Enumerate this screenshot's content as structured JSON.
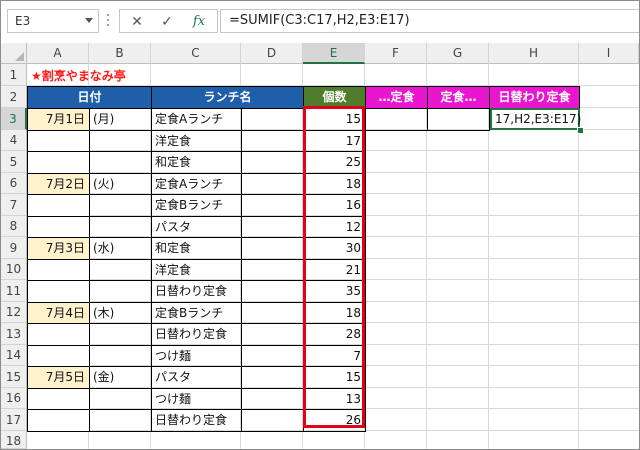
{
  "formula_bar": {
    "name_box": "E3",
    "cancel_icon": "✕",
    "enter_icon": "✓",
    "fx_label": "fx",
    "formula": "=SUMIF(C3:C17,H2,E3:E17)"
  },
  "columns": [
    "A",
    "B",
    "C",
    "D",
    "E",
    "F",
    "G",
    "H",
    "I"
  ],
  "rows": [
    "1",
    "2",
    "3",
    "4",
    "5",
    "6",
    "7",
    "8",
    "9",
    "10",
    "11",
    "12",
    "13",
    "14",
    "15",
    "16",
    "17",
    "18"
  ],
  "sheet": {
    "title": "★割烹やまなみ亭",
    "headers": {
      "date": "日付",
      "lunch": "ランチ名",
      "count": "個数",
      "f": "…定食",
      "g": "定食…",
      "h": "日替わり定食"
    },
    "active_cell_text": "17,H2,E3:E17)",
    "records": [
      {
        "date": "7月1日",
        "dow": "(月)",
        "lunch": "定食Aランチ",
        "count": "15"
      },
      {
        "date": "",
        "dow": "",
        "lunch": "洋定食",
        "count": "17"
      },
      {
        "date": "",
        "dow": "",
        "lunch": "和定食",
        "count": "25"
      },
      {
        "date": "7月2日",
        "dow": "(火)",
        "lunch": "定食Aランチ",
        "count": "18"
      },
      {
        "date": "",
        "dow": "",
        "lunch": "定食Bランチ",
        "count": "16"
      },
      {
        "date": "",
        "dow": "",
        "lunch": "パスタ",
        "count": "12"
      },
      {
        "date": "7月3日",
        "dow": "(水)",
        "lunch": "和定食",
        "count": "30"
      },
      {
        "date": "",
        "dow": "",
        "lunch": "洋定食",
        "count": "21"
      },
      {
        "date": "",
        "dow": "",
        "lunch": "日替わり定食",
        "count": "35"
      },
      {
        "date": "7月4日",
        "dow": "(木)",
        "lunch": "定食Bランチ",
        "count": "18"
      },
      {
        "date": "",
        "dow": "",
        "lunch": "日替わり定食",
        "count": "28"
      },
      {
        "date": "",
        "dow": "",
        "lunch": "つけ麺",
        "count": "7"
      },
      {
        "date": "7月5日",
        "dow": "(金)",
        "lunch": "パスタ",
        "count": "15"
      },
      {
        "date": "",
        "dow": "",
        "lunch": "つけ麺",
        "count": "13"
      },
      {
        "date": "",
        "dow": "",
        "lunch": "日替わり定食",
        "count": "26"
      }
    ]
  },
  "colors": {
    "header_blue": "#1f5ea8",
    "header_green": "#4f7d2b",
    "header_pink": "#e916cf",
    "date_fill": "#fff2cc",
    "title_red": "#ff1a1a",
    "highlight_red": "#e2001a",
    "excel_green": "#217346"
  }
}
